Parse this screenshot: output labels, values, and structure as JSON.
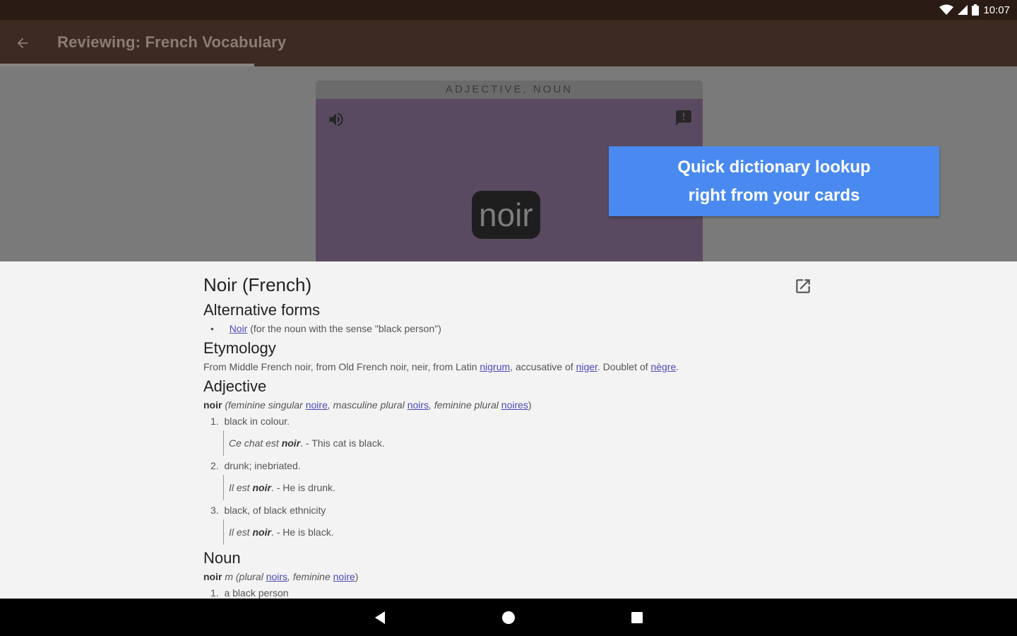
{
  "status_bar": {
    "time": "10:07"
  },
  "app_bar": {
    "title": "Reviewing: French Vocabulary",
    "progress": 0.25
  },
  "card": {
    "category": "ADJECTIVE, NOUN",
    "word": "noir"
  },
  "tooltip": {
    "line1": "Quick dictionary lookup",
    "line2": "right from your cards"
  },
  "dictionary": {
    "title": "Noir (French)",
    "alternative_forms": {
      "heading": "Alternative forms",
      "bullet": "•",
      "link": "Noir",
      "text": " (for the noun with the sense \"black person\")"
    },
    "etymology": {
      "heading": "Etymology",
      "pre": "From Middle French noir, from Old French noir, neir, from Latin ",
      "link1": "nigrum",
      "mid1": ", accusative of ",
      "link2": "niger",
      "mid2": ". Doublet of ",
      "link3": "nègre",
      "end": "."
    },
    "adjective": {
      "heading": "Adjective",
      "head_word": "noir",
      "p1": " (feminine singular ",
      "l1": "noire",
      "p2": ", masculine plural ",
      "l2": "noirs",
      "p3": ", feminine plural ",
      "l3": "noires",
      "p4": ")",
      "senses": [
        {
          "num": "1.",
          "def": "black in colour.",
          "ex_pre": "Ce chat est ",
          "ex_bold": "noir",
          "ex_post": ". - This cat is black."
        },
        {
          "num": "2.",
          "def": "drunk; inebriated.",
          "ex_pre": "Il est ",
          "ex_bold": "noir",
          "ex_post": ". - He is drunk."
        },
        {
          "num": "3.",
          "def": "black, of black ethnicity",
          "ex_pre": "Il est ",
          "ex_bold": "noir",
          "ex_post": ". - He is black."
        }
      ]
    },
    "noun": {
      "heading": "Noun",
      "head_word": "noir",
      "p1": " m (plural ",
      "l1": "noirs",
      "p2": ", feminine ",
      "l2": "noire",
      "p3": ")",
      "senses": [
        {
          "num": "1.",
          "def": "a black person"
        }
      ]
    }
  },
  "colors": {
    "status_bar": "#2a1b14",
    "app_bar": "#3d2a20",
    "card": "#5a4a61",
    "tooltip": "#4a8af0",
    "link": "#4a4ab6"
  },
  "icons": {
    "back": "arrow-left-icon",
    "sound": "speaker-icon",
    "comment": "comment-icon",
    "open_external": "open-external-icon",
    "nav_back": "triangle-back-icon",
    "nav_home": "circle-home-icon",
    "nav_recents": "square-recents-icon"
  }
}
